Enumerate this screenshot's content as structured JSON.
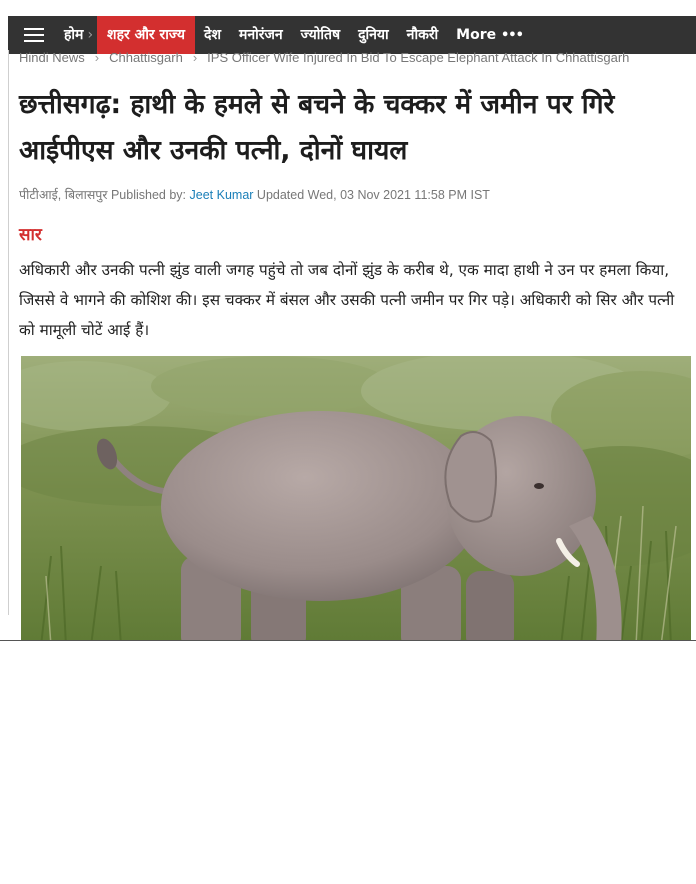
{
  "nav": {
    "items": [
      {
        "label": "होम"
      },
      {
        "label": "शहर और राज्य"
      },
      {
        "label": "देश"
      },
      {
        "label": "मनोरंजन"
      },
      {
        "label": "ज्योतिष"
      },
      {
        "label": "दुनिया"
      },
      {
        "label": "नौकरी"
      },
      {
        "label": "More"
      }
    ],
    "more_dots": "•••",
    "active_color": "#d32f2f",
    "bg_color": "#333333"
  },
  "breadcrumb": {
    "items": [
      "Hindi News",
      "Chhattisgarh",
      "IPS Officer Wife Injured In Bid To Escape Elephant Attack In Chhattisgarh"
    ],
    "separator": "›"
  },
  "article": {
    "headline": "छत्तीसगढ़: हाथी के हमले से बचने के चक्कर में जमीन पर गिरे आईपीएस और उनकी पत्नी, दोनों घायल",
    "byline": {
      "source": "पीटीआई, बिलासपुर",
      "published_label": "Published by:",
      "author": "Jeet Kumar",
      "updated": "Updated Wed, 03 Nov 2021 11:58 PM IST"
    },
    "summary_label": "सार",
    "summary": "अधिकारी और उनकी पत्नी झुंड वाली जगह पहुंचे तो जब दोनों झुंड के करीब थे, एक मादा हाथी ने उन पर हमला किया, जिससे वे भागने की कोशिश की। इस चक्कर में बंसल और उसकी पत्नी जमीन पर गिर पड़े। अधिकारी को सिर और पत्नी को मामूली चोटें आई हैं।",
    "image_subject": "elephant-photo"
  }
}
